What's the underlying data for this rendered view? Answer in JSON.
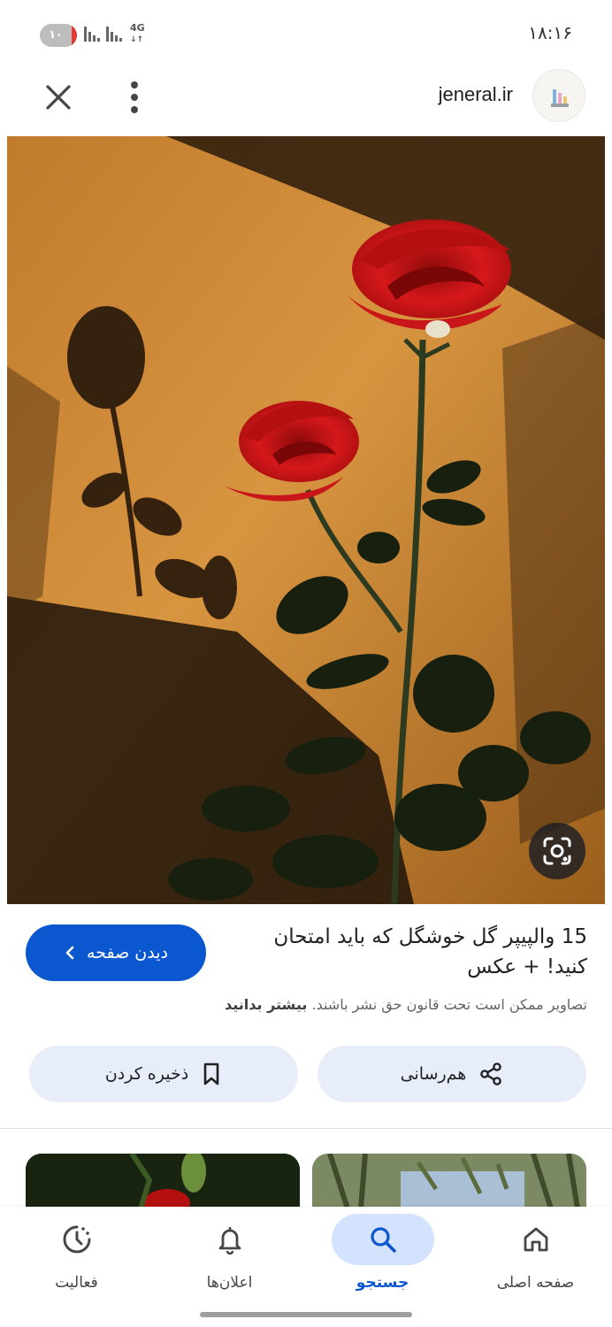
{
  "status_bar": {
    "time": "۱۸:۱۶",
    "battery_level": "۱۰",
    "network_type": "4G"
  },
  "header": {
    "site_name": "jeneral.ir",
    "icons": [
      "close-icon",
      "more-vert-icon",
      "site-logo"
    ]
  },
  "image": {
    "lens_icon": "google-lens-icon"
  },
  "result": {
    "title": "15 والپیپر گل خوشگل که باید امتحان کنید! + عکس",
    "visit_button_label": "دیدن صفحه",
    "copyright_notice": "تصاویر ممکن است تحت قانون حق نشر باشند.",
    "learn_more_label": "بیشتر بدانید"
  },
  "actions": {
    "share_label": "هم‌رسانی",
    "save_label": "ذخیره کردن"
  },
  "bottom_nav": {
    "items": [
      {
        "label": "صفحه اصلی",
        "icon": "home-icon",
        "active": false
      },
      {
        "label": "جستجو",
        "icon": "search-icon",
        "active": true
      },
      {
        "label": "اعلان‌ها",
        "icon": "bell-icon",
        "active": false
      },
      {
        "label": "فعالیت",
        "icon": "activity-icon",
        "active": false
      }
    ]
  },
  "colors": {
    "accent": "#0b57d0",
    "action_button_bg": "#e8eef9",
    "active_nav_pill": "#d3e3fd"
  }
}
